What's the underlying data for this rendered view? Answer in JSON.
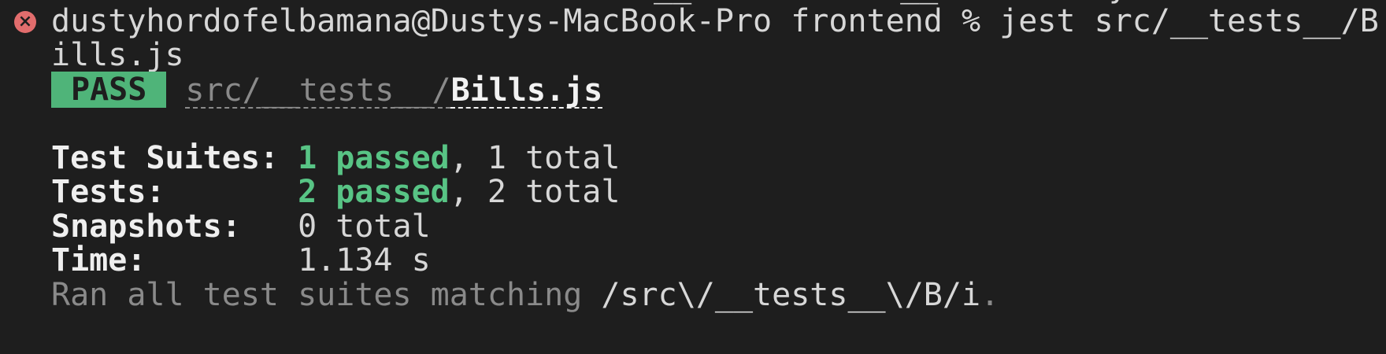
{
  "prompt": {
    "clipped_top": "__           __         y",
    "user_host": "dustyhordofelbamana@Dustys-MacBook-Pro",
    "directory": "frontend",
    "symbol": "%",
    "command_part1": "jest src/__tests__/B",
    "command_part2": "ills.js"
  },
  "result": {
    "badge": "PASS",
    "path_prefix": "src/__tests__/",
    "file": "Bills.js"
  },
  "summary": {
    "suites_label": "Test Suites:",
    "suites_passed": "1 passed",
    "suites_total": ", 1 total",
    "tests_label": "Tests:",
    "tests_passed": "2 passed",
    "tests_total": ", 2 total",
    "snapshots_label": "Snapshots:",
    "snapshots_value": "0 total",
    "time_label": "Time:",
    "time_value": "1.134 s"
  },
  "footer": {
    "ran_text": "Ran all test suites matching",
    "pattern": "/src\\/__tests__\\/B/i",
    "period": "."
  },
  "colors": {
    "background": "#1e1e1e",
    "pass_badge": "#4fb479",
    "passed_text": "#58c485",
    "error_icon": "#e26d6d"
  }
}
